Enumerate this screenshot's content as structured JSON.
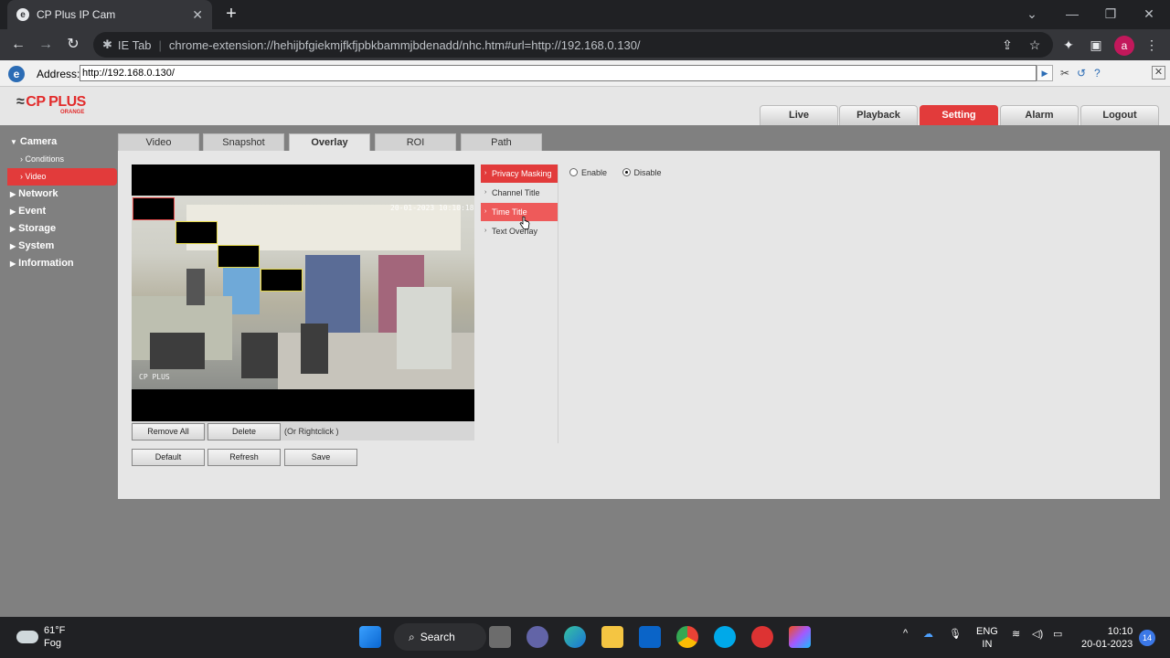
{
  "browser": {
    "tab_title": "CP Plus IP Cam",
    "tab_favicon": "e",
    "url_prefix": "IE Tab",
    "url": "chrome-extension://hehijbfgiekmjfkfjpbkbammjbdenadd/nhc.htm#url=http://192.168.0.130/",
    "profile_initial": "a"
  },
  "ie_toolbar": {
    "address_label": "Address:",
    "address_value": "http://192.168.0.130/"
  },
  "app": {
    "logo": "CP PLUS",
    "logo_sub": "ORANGE",
    "top_nav": [
      {
        "label": "Live",
        "active": false
      },
      {
        "label": "Playback",
        "active": false
      },
      {
        "label": "Setting",
        "active": true
      },
      {
        "label": "Alarm",
        "active": false
      },
      {
        "label": "Logout",
        "active": false
      }
    ],
    "sidebar": {
      "camera": "Camera",
      "conditions": "Conditions",
      "video": "Video",
      "network": "Network",
      "event": "Event",
      "storage": "Storage",
      "system": "System",
      "information": "Information"
    },
    "subtabs": [
      "Video",
      "Snapshot",
      "Overlay",
      "ROI",
      "Path"
    ],
    "active_subtab": "Overlay",
    "osd": {
      "timestamp": "20-01-2023 10:10:18",
      "channel": "CP PLUS"
    },
    "buttons": {
      "remove_all": "Remove All",
      "delete": "Delete",
      "hint": "(Or Rightclick )",
      "default": "Default",
      "refresh": "Refresh",
      "save": "Save"
    },
    "overlay_menu": [
      "Privacy Masking",
      "Channel Title",
      "Time Title",
      "Text Overlay"
    ],
    "options": {
      "enable": "Enable",
      "disable": "Disable",
      "selected": "Disable"
    },
    "accent_color": "#e23b3b"
  },
  "taskbar": {
    "temp": "61°F",
    "condition": "Fog",
    "search": "Search",
    "lang_1": "ENG",
    "lang_2": "IN",
    "time": "10:10",
    "date": "20-01-2023",
    "notifications": "14"
  }
}
